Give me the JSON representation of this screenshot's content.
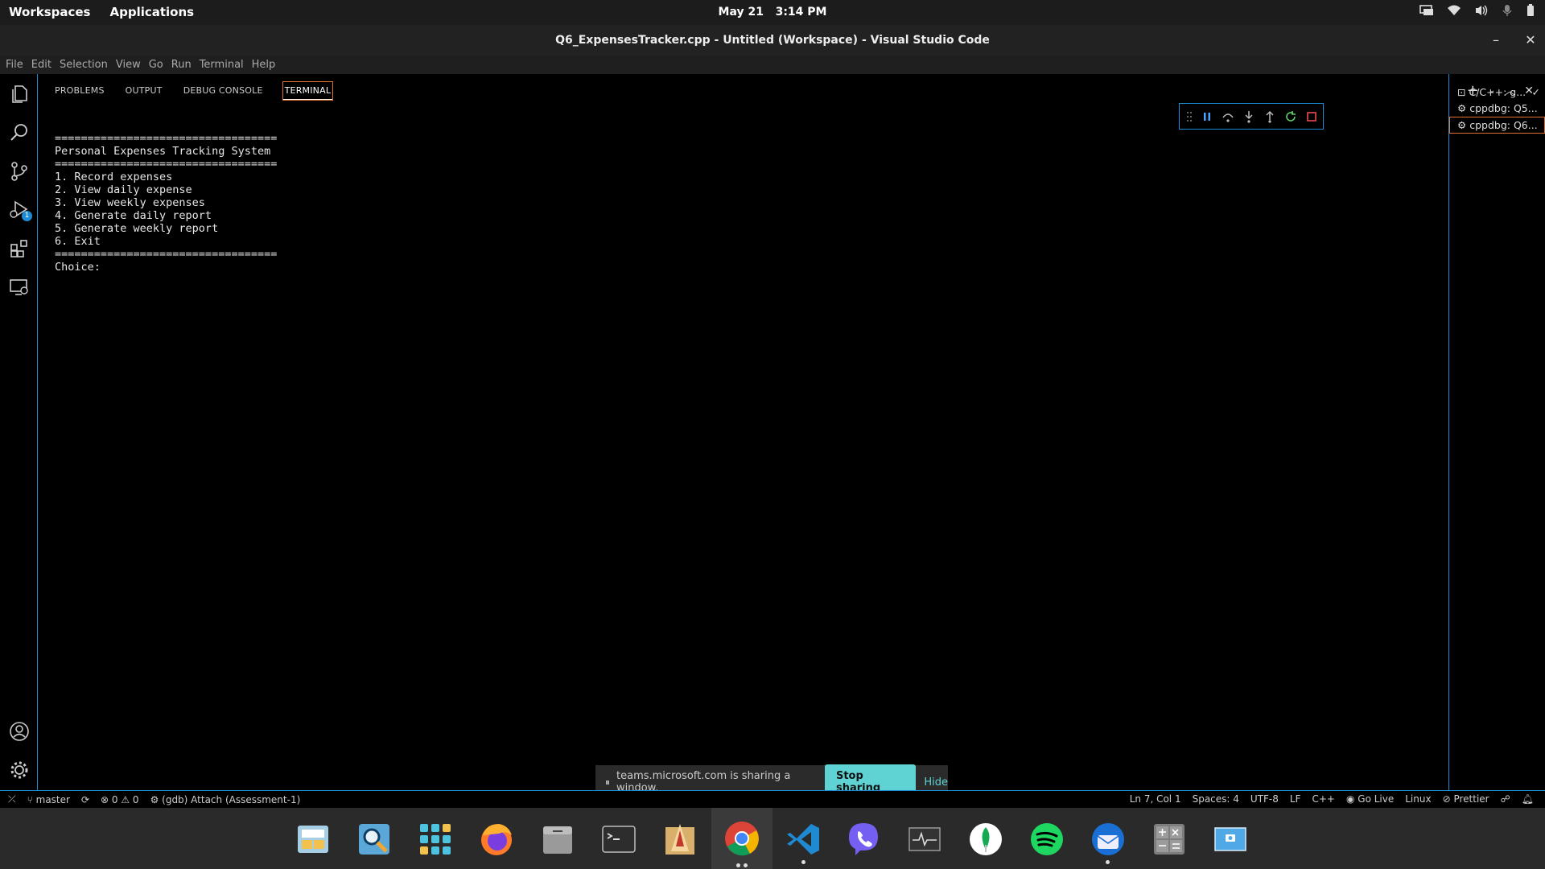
{
  "topbar": {
    "workspaces": "Workspaces",
    "applications": "Applications",
    "date": "May 21",
    "time": "3:14 PM"
  },
  "window": {
    "title": "Q6_ExpensesTracker.cpp - Untitled (Workspace) - Visual Studio Code"
  },
  "menu": [
    "File",
    "Edit",
    "Selection",
    "View",
    "Go",
    "Run",
    "Terminal",
    "Help"
  ],
  "panel": {
    "tabs": [
      "PROBLEMS",
      "OUTPUT",
      "DEBUG CONSOLE",
      "TERMINAL"
    ],
    "active_tab": "TERMINAL"
  },
  "terminal": {
    "lines": [
      "==================================",
      "Personal Expenses Tracking System",
      "==================================",
      "1. Record expenses",
      "2. View daily expense",
      "3. View weekly expenses",
      "4. Generate daily report",
      "5. Generate weekly report",
      "6. Exit",
      "==================================",
      "Choice:"
    ]
  },
  "terminal_list": [
    {
      "label": "C/C++: g...",
      "icon": "terminal-icon"
    },
    {
      "label": "cppdbg: Q5...",
      "icon": "gear-icon"
    },
    {
      "label": "cppdbg: Q6...",
      "icon": "gear-icon",
      "selected": true
    }
  ],
  "share_notice": {
    "text": "teams.microsoft.com is sharing a window.",
    "stop": "Stop sharing",
    "hide": "Hide"
  },
  "statusbar": {
    "branch": "master",
    "errors": "0",
    "warnings": "0",
    "debug": "(gdb) Attach (Assessment-1)",
    "position": "Ln 7, Col 1",
    "spaces": "Spaces: 4",
    "encoding": "UTF-8",
    "eol": "LF",
    "language": "C++",
    "golive": "Go Live",
    "platform": "Linux",
    "prettier": "Prettier"
  },
  "activity_badge": "1",
  "colors": {
    "accent": "#1d8cd6",
    "focus": "#e2722a",
    "share_button": "#5fd3d3"
  }
}
